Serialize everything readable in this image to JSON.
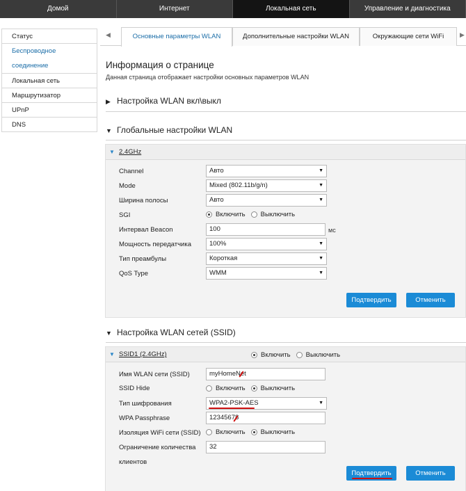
{
  "topnav": {
    "tabs": [
      {
        "label": "Домой"
      },
      {
        "label": "Интернет"
      },
      {
        "label": "Локальная сеть"
      },
      {
        "label": "Управление и диагностика"
      }
    ]
  },
  "sidebar": {
    "items": [
      {
        "label": "Статус"
      },
      {
        "label": "Беспроводное соединение"
      },
      {
        "label": "Локальная сеть"
      },
      {
        "label": "Маршрутизатор"
      },
      {
        "label": "UPnP"
      },
      {
        "label": "DNS"
      }
    ],
    "wireless_line1": "Беспроводное",
    "wireless_line2": "соединение"
  },
  "subtabs": {
    "left_arrow": "◀",
    "right_arrow": "▶",
    "items": [
      {
        "label": "Основные параметры WLAN"
      },
      {
        "label": "Дополнительные настройки WLAN"
      },
      {
        "label": "Окружающие сети WiFi"
      }
    ]
  },
  "page": {
    "title": "Информация о странице",
    "description": "Данная страница отображает настройки основных параметров WLAN"
  },
  "sections": {
    "wlan_onoff": "Настройка WLAN вкл\\выкл",
    "global": "Глобальные настройки WLAN",
    "ssid": "Настройка WLAN сетей (SSID)"
  },
  "global_panel": {
    "band": "2.4GHz",
    "channel_label": "Channel",
    "channel_value": "Авто",
    "mode_label": "Mode",
    "mode_value": "Mixed (802.11b/g/n)",
    "bandwidth_label": "Ширина полосы",
    "bandwidth_value": "Авто",
    "sgi_label": "SGI",
    "sgi_on": "Включить",
    "sgi_off": "Выключить",
    "beacon_label": "Интервал Beacon",
    "beacon_value": "100",
    "beacon_unit": "мс",
    "power_label": "Мощность передатчика",
    "power_value": "100%",
    "preamble_label": "Тип преамбулы",
    "preamble_value": "Короткая",
    "qos_label": "QoS Type",
    "qos_value": "WMM",
    "confirm": "Подтвердить",
    "cancel": "Отменить"
  },
  "ssid_panel": {
    "name": "SSID1 (2.4GHz)",
    "enable": "Включить",
    "disable": "Выключить",
    "ssid_name_label": "Имя WLAN сети (SSID)",
    "ssid_name_value": "myHomeNet",
    "ssid_hide_label": "SSID Hide",
    "hide_on": "Включить",
    "hide_off": "Выключить",
    "encryption_label": "Тип шифрования",
    "encryption_value": "WPA2-PSK-AES",
    "passphrase_label": "WPA Passphrase",
    "passphrase_value": "12345678",
    "isolation_label": "Изоляция WiFi сети (SSID)",
    "iso_on": "Включить",
    "iso_off": "Выключить",
    "clients_label_1": "Ограничение количества",
    "clients_label_2": "клиентов",
    "clients_value": "32",
    "confirm": "Подтвердить",
    "cancel": "Отменить"
  },
  "colors": {
    "accent": "#1b8bd6",
    "nav_bg": "#3a3a3a",
    "nav_active": "#141414",
    "annotation": "#d01010"
  }
}
